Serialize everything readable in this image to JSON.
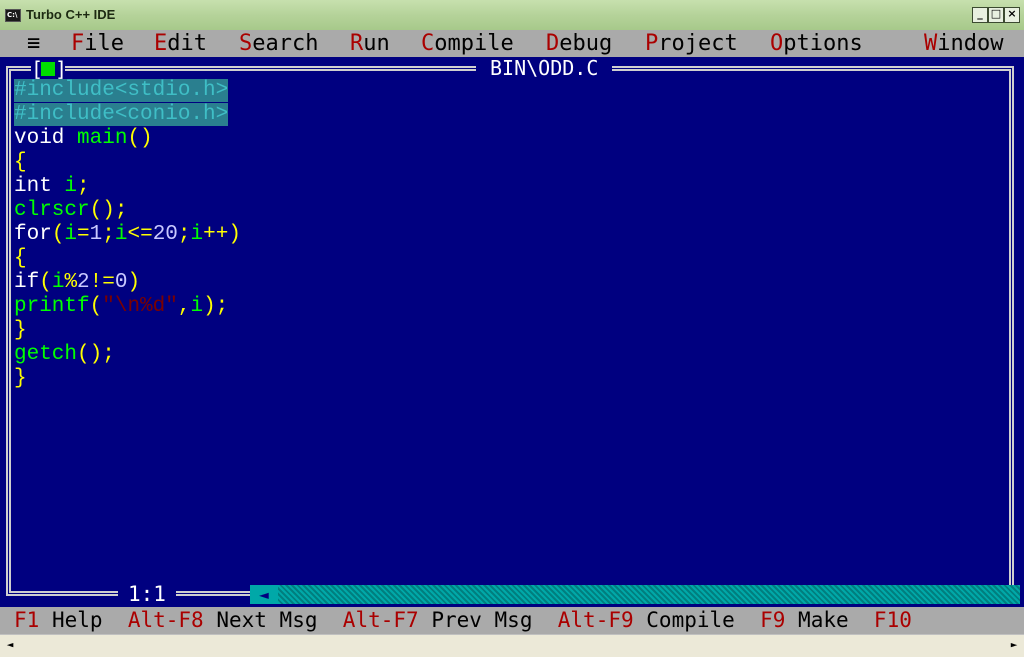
{
  "window": {
    "title": "Turbo C++ IDE",
    "icon_label": "C:\\",
    "controls": {
      "minimize": "_",
      "maximize": "□",
      "close": "×"
    }
  },
  "menu": {
    "system_glyph": "≡",
    "items": [
      {
        "hot": "F",
        "rest": "ile"
      },
      {
        "hot": "E",
        "rest": "dit"
      },
      {
        "hot": "S",
        "rest": "earch"
      },
      {
        "hot": "R",
        "rest": "un"
      },
      {
        "hot": "C",
        "rest": "ompile"
      },
      {
        "hot": "D",
        "rest": "ebug"
      },
      {
        "hot": "P",
        "rest": "roject"
      },
      {
        "hot": "O",
        "rest": "ptions"
      },
      {
        "hot": "W",
        "rest": "indow"
      }
    ]
  },
  "editor": {
    "file_title": "BIN\\ODD.C",
    "close_left": "[",
    "close_right": "]",
    "cursor_position": "1:1",
    "scroll_arrow": "◄",
    "code": {
      "l1": "#include<stdio.h>",
      "l2": "#include<conio.h>",
      "l3_kw": "void",
      "l3_fn": "main",
      "l3_br": "()",
      "l4": "{",
      "l5_kw": "int",
      "l5_id": "i",
      "l5_semi": ";",
      "l6_fn": "clrscr",
      "l6_br": "();",
      "l7_kw": "for",
      "l7_a": "(",
      "l7_b": "i",
      "l7_c": "=",
      "l7_d": "1",
      "l7_e": ";",
      "l7_f": "i",
      "l7_g": "<=",
      "l7_h": "20",
      "l7_i": ";",
      "l7_j": "i",
      "l7_k": "++)",
      "l8": "{",
      "l9_kw": "if",
      "l9_a": "(",
      "l9_b": "i",
      "l9_c": "%",
      "l9_d": "2",
      "l9_e": "!=",
      "l9_f": "0",
      "l9_g": ")",
      "l10_fn": "printf",
      "l10_a": "(",
      "l10_str": "\"\\n%d\"",
      "l10_b": ",",
      "l10_c": "i",
      "l10_d": ");",
      "l11": "}",
      "l12_fn": "getch",
      "l12_br": "();",
      "l13": "}"
    }
  },
  "status": {
    "items": [
      {
        "key": "F1",
        "label": "Help"
      },
      {
        "key": "Alt-F8",
        "label": "Next Msg"
      },
      {
        "key": "Alt-F7",
        "label": "Prev Msg"
      },
      {
        "key": "Alt-F9",
        "label": "Compile"
      },
      {
        "key": "F9",
        "label": "Make"
      },
      {
        "key": "F10",
        "label": ""
      }
    ]
  },
  "winscroll": {
    "left": "◄",
    "right": "►"
  },
  "colors": {
    "editor_bg": "#000080",
    "menu_bg": "#aaaaaa",
    "hotkey": "#aa0000",
    "keyword": "#ffffff",
    "identifier": "#00ff00",
    "brace": "#ffff00",
    "selection": "#2a7f8f"
  }
}
